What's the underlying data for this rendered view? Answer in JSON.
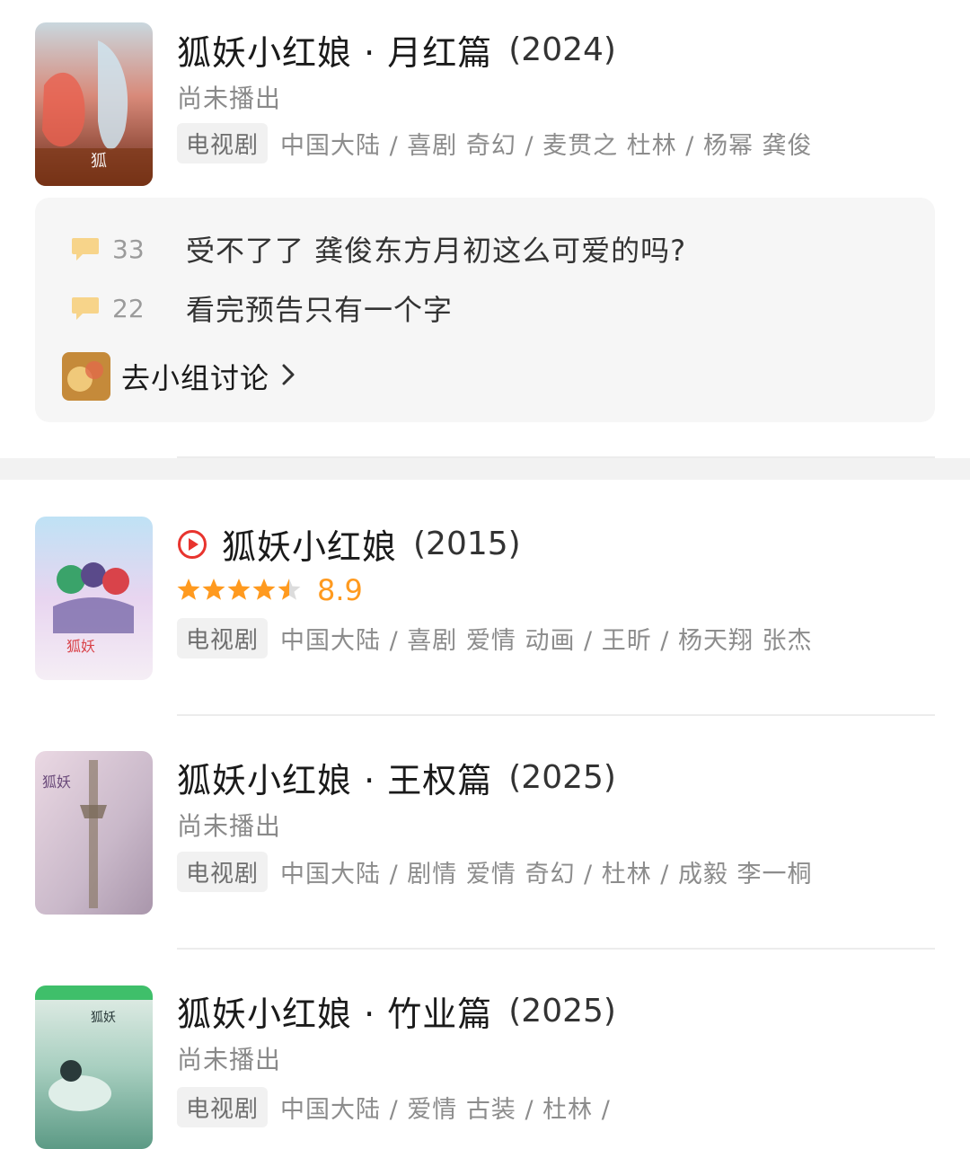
{
  "items": [
    {
      "title": "狐妖小红娘 · 月红篇",
      "year": "(2024)",
      "status": "尚未播出",
      "tag": "电视剧",
      "meta": "中国大陆 / 喜剧 奇幻 / 麦贯之 杜林 / 杨幂 龚俊"
    },
    {
      "title": "狐妖小红娘",
      "year": "(2015)",
      "rating": "8.9",
      "tag": "电视剧",
      "meta": "中国大陆 / 喜剧 爱情 动画 / 王昕 / 杨天翔 张杰"
    },
    {
      "title": "狐妖小红娘 · 王权篇",
      "year": "(2025)",
      "status": "尚未播出",
      "tag": "电视剧",
      "meta": "中国大陆 / 剧情 爱情 奇幻 / 杜林 / 成毅 李一桐"
    },
    {
      "title": "狐妖小红娘 · 竹业篇",
      "year": "(2025)",
      "status": "尚未播出",
      "tag": "电视剧",
      "meta": "中国大陆 / 爱情 古装 / 杜林 /"
    }
  ],
  "discussion": {
    "comments": [
      {
        "count": "33",
        "text": "受不了了 龚俊东方月初这么可爱的吗?"
      },
      {
        "count": "22",
        "text": "看完预告只有一个字"
      }
    ],
    "group_link": "去小组讨论"
  },
  "colors": {
    "rating": "#ff9a1f",
    "play_icon": "#e8342e",
    "bubble": "#f7d48a"
  }
}
